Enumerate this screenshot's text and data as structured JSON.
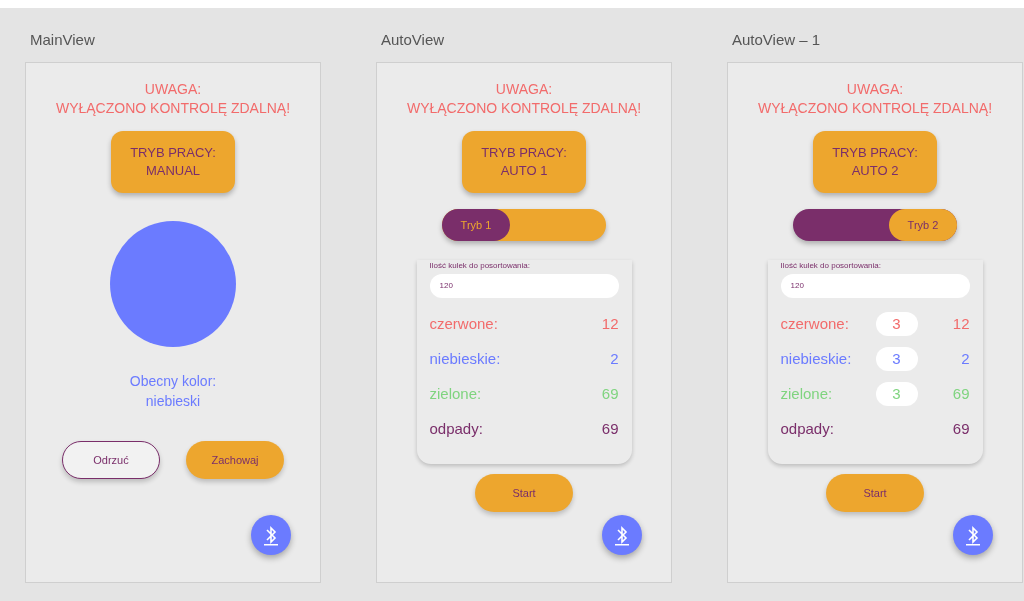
{
  "screens": [
    {
      "kind": "main",
      "title": "MainView",
      "warning": [
        "UWAGA:",
        "WYŁĄCZONO KONTROLĘ ZDALNĄ!"
      ],
      "mode": [
        "TRYB PRACY:",
        "MANUAL"
      ],
      "color_label": [
        "Obecny kolor:",
        "niebieski"
      ],
      "buttons": [
        {
          "label": "Odrzuć",
          "kind": "outline"
        },
        {
          "label": "Zachowaj",
          "kind": "filled"
        }
      ]
    },
    {
      "kind": "auto",
      "title": "AutoView",
      "warning": [
        "UWAGA:",
        "WYŁĄCZONO KONTROLĘ ZDALNĄ!"
      ],
      "mode": [
        "TRYB PRACY:",
        "AUTO 1"
      ],
      "toggle": {
        "label": "Tryb 1",
        "on": false
      },
      "count_label": "Ilość kulek do posortowania:",
      "count_value": "120",
      "rows": [
        {
          "label": "czerwone:",
          "color": "#f26b6b",
          "count": "12"
        },
        {
          "label": "niebieskie:",
          "color": "#6b7bff",
          "count": "2"
        },
        {
          "label": "zielone:",
          "color": "#7fd47f",
          "count": "69"
        },
        {
          "label": "odpady:",
          "color": "#7a2e6a",
          "count": "69"
        }
      ],
      "start": "Start"
    },
    {
      "kind": "auto",
      "title": "AutoView – 1",
      "warning": [
        "UWAGA:",
        "WYŁĄCZONO KONTROLĘ ZDALNĄ!"
      ],
      "mode": [
        "TRYB PRACY:",
        "AUTO 2"
      ],
      "toggle": {
        "label": "Tryb 2",
        "on": true
      },
      "count_label": "Ilość kulek do posortowania:",
      "count_value": "120",
      "rows": [
        {
          "label": "czerwone:",
          "color": "#f26b6b",
          "input": "3",
          "count": "12"
        },
        {
          "label": "niebieskie:",
          "color": "#6b7bff",
          "input": "3",
          "count": "2"
        },
        {
          "label": "zielone:",
          "color": "#7fd47f",
          "input": "3",
          "count": "69"
        },
        {
          "label": "odpady:",
          "color": "#7a2e6a",
          "count": "69"
        }
      ],
      "start": "Start"
    }
  ]
}
